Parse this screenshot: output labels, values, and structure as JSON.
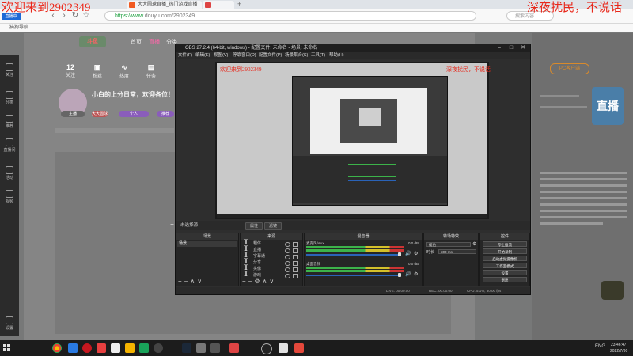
{
  "overlay": {
    "welcome": "欢迎来到2902349",
    "late_night": "深夜扰民，不说话",
    "live_tag": "直播中"
  },
  "browser": {
    "tab_label": "大大圆球直播_热门游戏直播",
    "url_secure": "https://www.",
    "url_rest": "douyu.com/2902349",
    "search_placeholder": "搜索内容",
    "bookmark": "猫狗导航"
  },
  "site": {
    "logo": "斗鱼",
    "nav": [
      "首页",
      "直播",
      "分类"
    ],
    "stats": [
      {
        "value": "12",
        "label": "关注"
      },
      {
        "value": "",
        "label": "粉丝"
      },
      {
        "value": "",
        "label": "热度"
      },
      {
        "value": "",
        "label": "任务"
      }
    ],
    "welcome": "小白的上分日常，欢迎各位！！",
    "pills": [
      "主播",
      "大大圆球",
      "个人",
      "推荐"
    ],
    "pc_client": "PC客户端",
    "side_ad": "直播",
    "left_nav": [
      "关注",
      "分类",
      "推荐",
      "直播间",
      "活动",
      "视频",
      "设置"
    ]
  },
  "obs": {
    "title": "OBS 27.2.4 (64-bit, windows) - 配置文件: 未命名 - 场景: 未命名",
    "menu": [
      "文件(F)",
      "编辑(E)",
      "视图(V)",
      "停靠窗口(D)",
      "配置文件(P)",
      "场景集合(S)",
      "工具(T)",
      "帮助(H)"
    ],
    "preview_overlay_left": "欢迎来到2902349",
    "preview_overlay_right": "深夜扰民，不说话",
    "no_source": "未选择源",
    "props_btn": "属性",
    "filters_btn": "滤镜",
    "docks": {
      "scenes": "场景",
      "sources": "来源",
      "mixer": "混音器",
      "transitions": "转场特效",
      "controls": "控件"
    },
    "scenes": [
      "场景"
    ],
    "sources": [
      "粗体",
      "直播",
      "字幕通",
      "分享",
      "头像",
      "游戏"
    ],
    "mixer": [
      {
        "name": "麦克风/Aux",
        "db": "0.0 dB"
      },
      {
        "name": "桌面音频",
        "db": "0.0 dB"
      }
    ],
    "transition": {
      "label": "褪色",
      "duration_label": "时长",
      "duration": "300 ms"
    },
    "controls": [
      "停止推流",
      "开始录制",
      "启动虚拟摄像机",
      "工作室模式",
      "设置",
      "退出"
    ],
    "status": {
      "live": "LIVE: 00:00:00",
      "rec": "REC: 00:00:00",
      "cpu": "CPU: 5.1%, 30.00 fps"
    }
  },
  "taskbar": {
    "lang": "ENG",
    "time": "23:46:47",
    "date": "2022/7/30"
  },
  "colors": {
    "accent_red": "#e8281b",
    "obs_dark": "#2e2e2e",
    "meter_green": "#3cb34a",
    "meter_yellow": "#d3c02a"
  }
}
